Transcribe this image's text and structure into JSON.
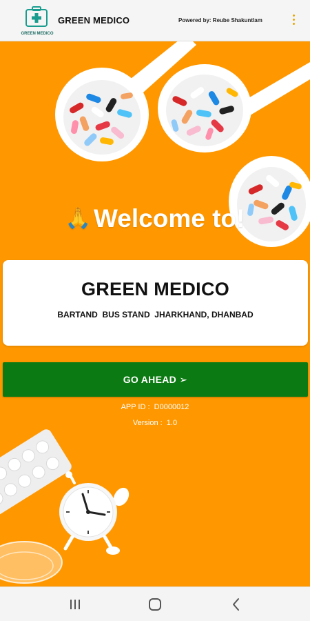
{
  "app_bar": {
    "logo_text": "GREEN MEDICO",
    "title": "GREEN MEDICO",
    "powered_by": "Powered by: Reube Shakuntlam",
    "menu_icon": "more-vertical-icon"
  },
  "main": {
    "welcome_emoji": "🙏",
    "welcome_text": "Welcome to!",
    "store": {
      "name": "GREEN MEDICO",
      "address": "BARTAND  BUS STAND  JHARKHAND, DHANBAD"
    },
    "go_button_label": "GO AHEAD ➢",
    "app_id": "APP ID :  D0000012",
    "version": "Version :  1.0"
  },
  "nav_bar": {
    "recents_icon": "recent-apps-icon",
    "home_icon": "home-icon",
    "back_icon": "back-icon"
  },
  "colors": {
    "background": "#ff9800",
    "button": "#0b7a12",
    "logo": "#1a9d8f",
    "menu_dots": "#e6a800"
  }
}
